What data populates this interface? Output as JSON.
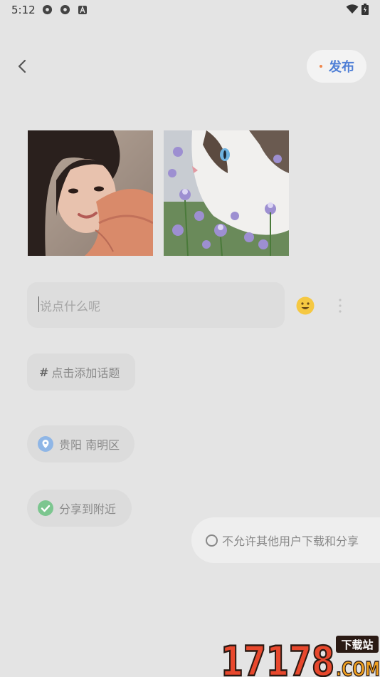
{
  "status_bar": {
    "time": "5:12"
  },
  "header": {
    "publish_label": "发布"
  },
  "photos": [
    {
      "name": "portrait-photo"
    },
    {
      "name": "cat-photo"
    }
  ],
  "composer": {
    "placeholder": "说点什么呢"
  },
  "topic": {
    "label": "点击添加话题",
    "hash": "#"
  },
  "location": {
    "label": "贵阳 南明区"
  },
  "nearby": {
    "label": "分享到附近"
  },
  "download_option": {
    "label": "不允许其他用户下载和分享"
  },
  "watermark": {
    "main": "17178",
    "suffix": ".COM",
    "badge": "下载站"
  },
  "colors": {
    "accent": "#4f7fd6",
    "location_icon": "#8fb6e6",
    "check_icon": "#7cc68f",
    "emoji": "#f5c842"
  }
}
